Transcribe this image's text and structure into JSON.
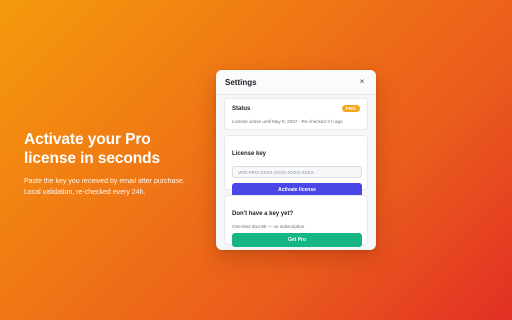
{
  "hero": {
    "title_line1": "Activate your Pro",
    "title_line2": "license in seconds",
    "sub_line1": "Paste the key you received by email after purchase.",
    "sub_line2": "Local validation, re-checked every 24h."
  },
  "window": {
    "title": "Settings",
    "close_glyph": "×"
  },
  "status_card": {
    "label": "Status",
    "badge": "PRO",
    "text": "License active until May 8, 2027 · Re-checked 3 h ago"
  },
  "license_card": {
    "label": "License key",
    "input_value": "",
    "input_placeholder": "VFD-PRO-XXXX-XXXX-XXXX-XXXX",
    "button_label": "Activate license"
  },
  "buy_card": {
    "label": "Don't have a key yet?",
    "note": "One-time $14.99 — no subscription.",
    "button_label": "Get Pro"
  },
  "colors": {
    "accent": "#4b47e6",
    "buy": "#15b584",
    "badge": "#f4a81f",
    "gradient_start": "#f59a0c",
    "gradient_end": "#e22f24"
  },
  "icons": {
    "close": "close-icon"
  }
}
